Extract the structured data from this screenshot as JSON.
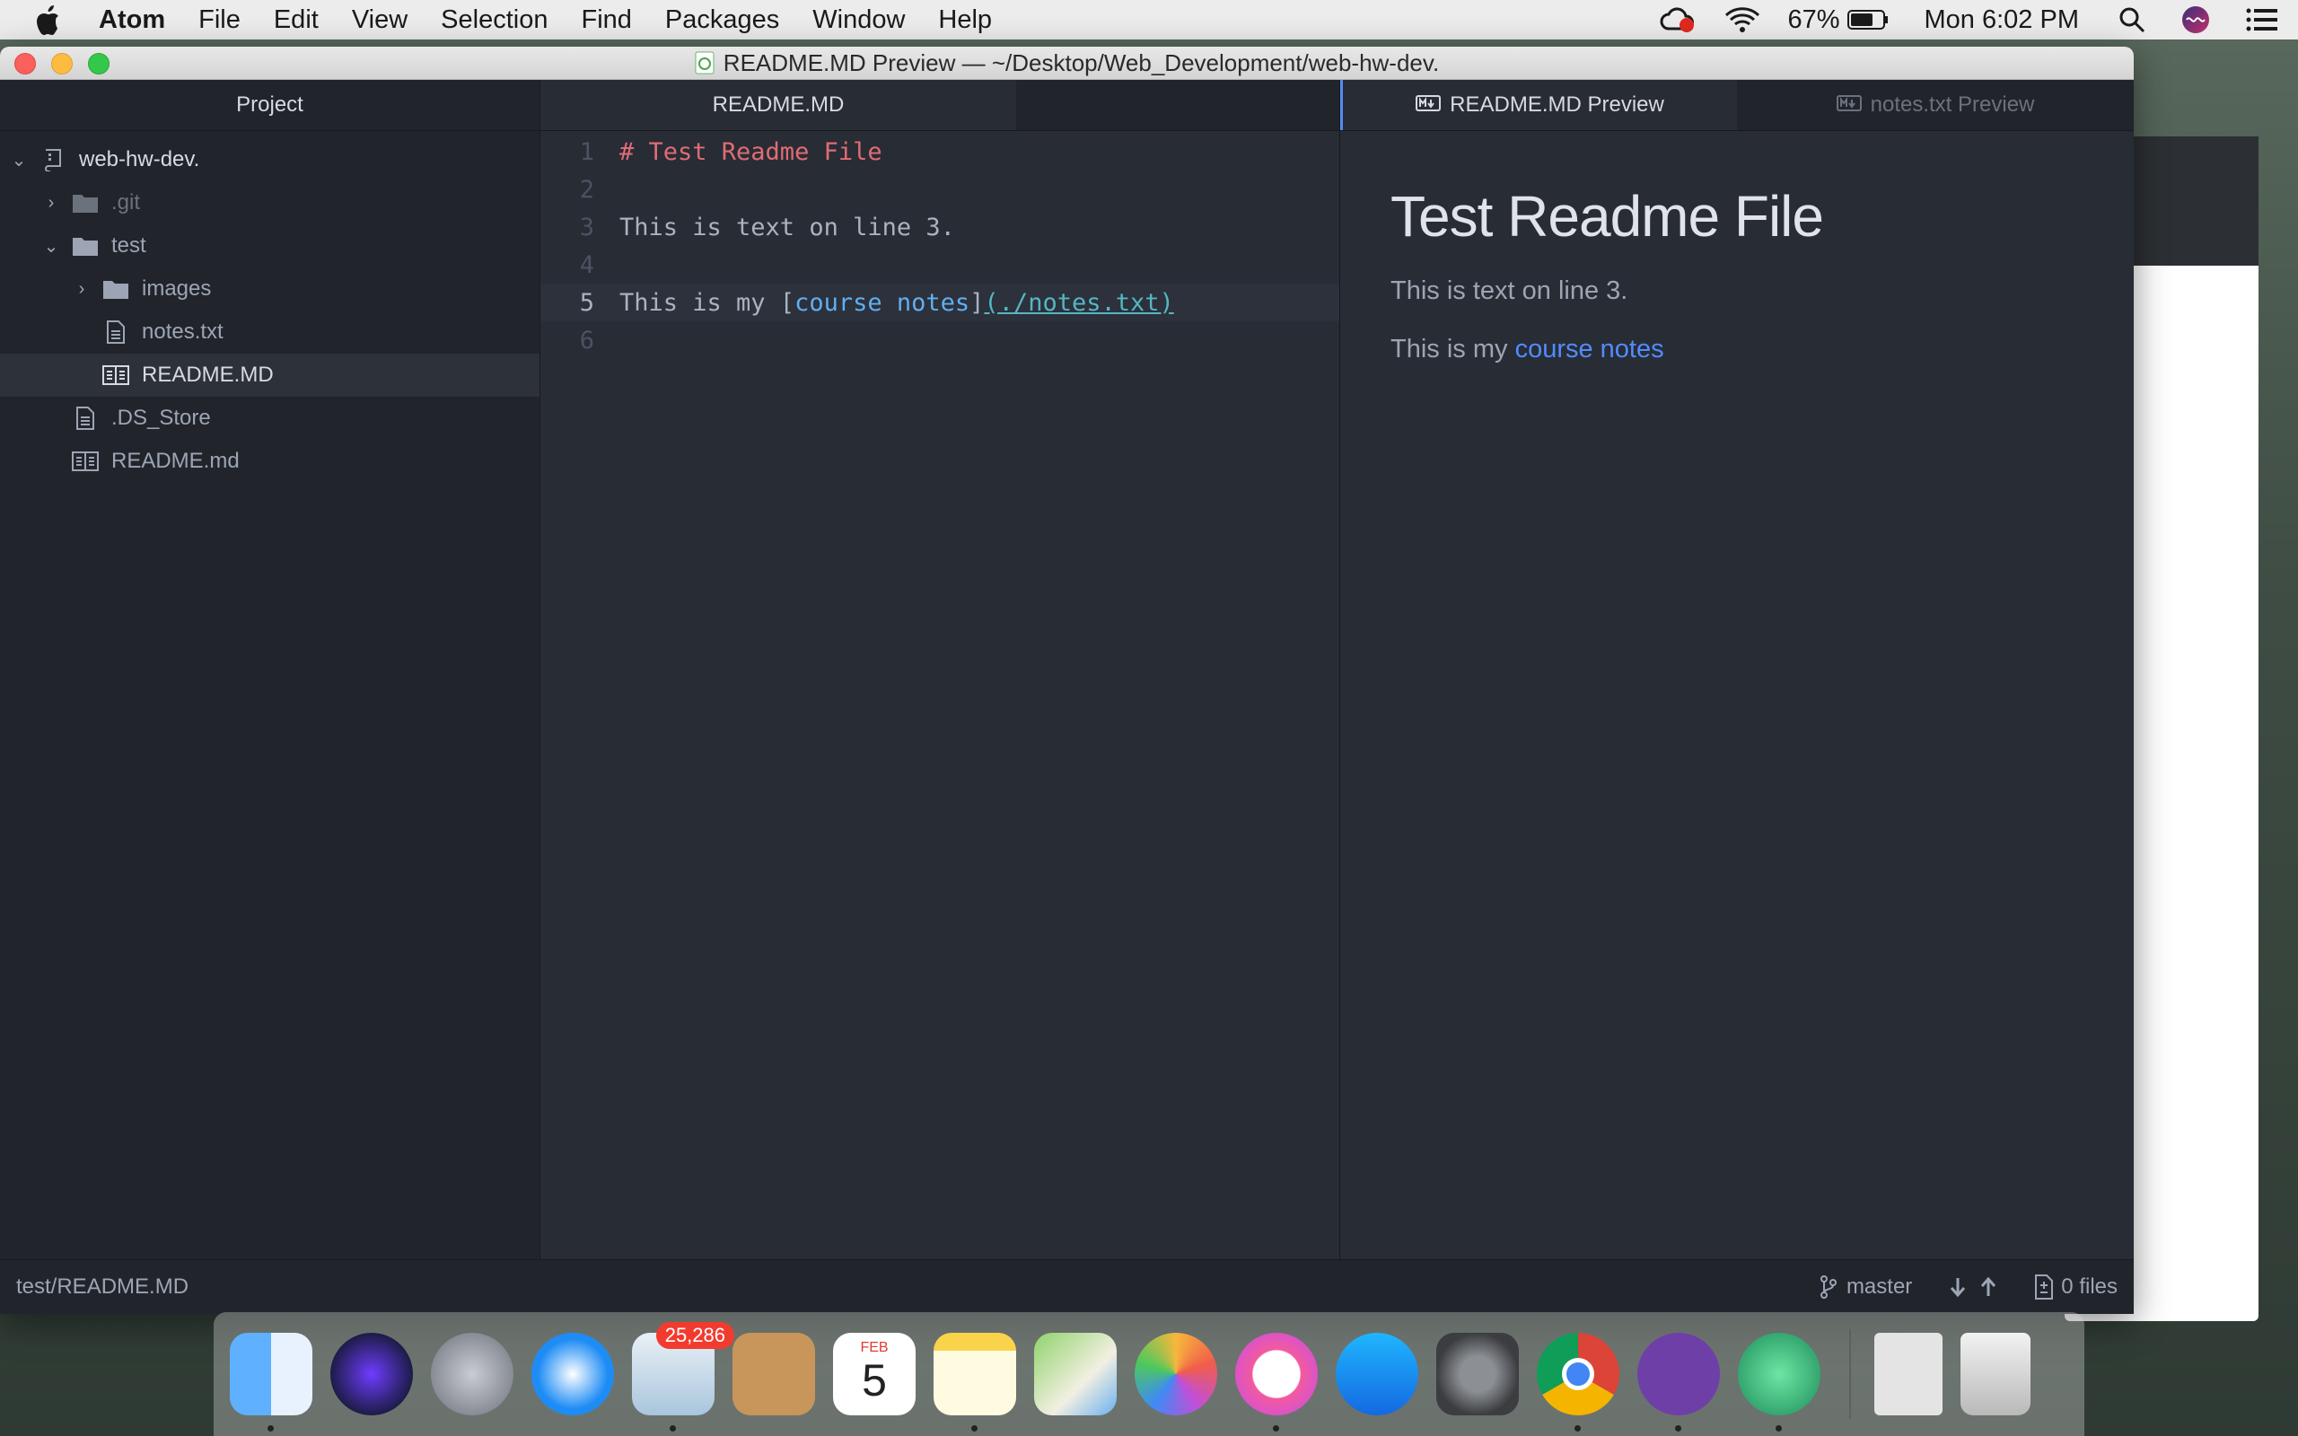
{
  "menubar": {
    "app": "Atom",
    "items": [
      "File",
      "Edit",
      "View",
      "Selection",
      "Find",
      "Packages",
      "Window",
      "Help"
    ],
    "battery": "67%",
    "clock": "Mon 6:02 PM"
  },
  "window": {
    "title": "README.MD Preview — ~/Desktop/Web_Development/web-hw-dev."
  },
  "tree": {
    "header": "Project",
    "root": "web-hw-dev.",
    "items": {
      "git": ".git",
      "test": "test",
      "images": "images",
      "notes": "notes.txt",
      "readme_sel": "README.MD",
      "ds_store": ".DS_Store",
      "readme_root": "README.md"
    }
  },
  "editor": {
    "tab": "README.MD",
    "lines": {
      "l1": "# Test Readme File",
      "l3": "This is text on line 3.",
      "l5_pre": "This is my ",
      "l5_open": "[",
      "l5_link": "course notes",
      "l5_close": "]",
      "l5_url": "(./notes.txt)"
    },
    "line_numbers": [
      "1",
      "2",
      "3",
      "4",
      "5",
      "6"
    ]
  },
  "preview": {
    "tab_active": "README.MD Preview",
    "tab_inactive": "notes.txt Preview",
    "h1": "Test Readme File",
    "p1": "This is text on line 3.",
    "p2_pre": "This is my ",
    "p2_link": "course notes"
  },
  "statusbar": {
    "path": "test/README.MD",
    "branch": "master",
    "files": "0 files"
  },
  "dock": {
    "mail_badge": "25,286",
    "calendar_month": "FEB",
    "calendar_day": "5"
  },
  "colors": {
    "accent": "#568af2",
    "heading_red": "#e06c75",
    "link_blue": "#61afef"
  }
}
